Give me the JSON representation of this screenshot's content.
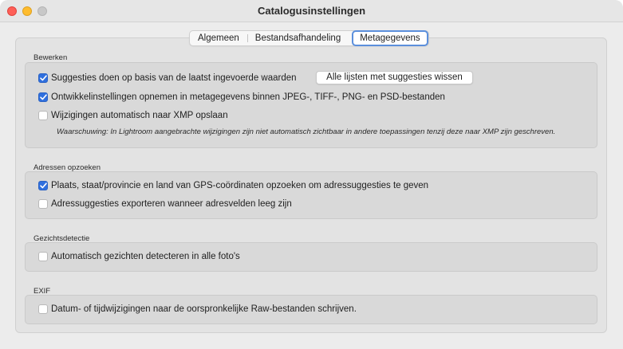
{
  "window": {
    "title": "Catalogusinstellingen",
    "controls": [
      "close",
      "minimize",
      "maximize"
    ]
  },
  "tabs": [
    {
      "label": "Algemeen",
      "active": false
    },
    {
      "label": "Bestandsafhandeling",
      "active": false
    },
    {
      "label": "Metagegevens",
      "active": true
    }
  ],
  "sections": {
    "bewerken": {
      "label": "Bewerken",
      "options": [
        {
          "label": "Suggesties doen op basis van de laatst ingevoerde waarden",
          "checked": true
        },
        {
          "label": "Ontwikkelinstellingen opnemen in metagegevens binnen JPEG-, TIFF-, PNG- en PSD-bestanden",
          "checked": true
        },
        {
          "label": "Wijzigingen automatisch naar XMP opslaan",
          "checked": false
        }
      ],
      "clear_button": "Alle lijsten met suggesties wissen",
      "warning": "Waarschuwing: In Lightroom aangebrachte wijzigingen zijn niet automatisch zichtbaar in andere toepassingen tenzij deze naar XMP zijn geschreven."
    },
    "adressen": {
      "label": "Adressen opzoeken",
      "options": [
        {
          "label": "Plaats, staat/provincie en land van GPS-coördinaten opzoeken om adressuggesties te geven",
          "checked": true
        },
        {
          "label": "Adressuggesties exporteren wanneer adresvelden leeg zijn",
          "checked": false
        }
      ]
    },
    "gezichten": {
      "label": "Gezichtsdetectie",
      "options": [
        {
          "label": "Automatisch gezichten detecteren in alle foto's",
          "checked": false
        }
      ]
    },
    "exif": {
      "label": "EXIF",
      "options": [
        {
          "label": "Datum- of tijdwijzigingen naar de oorspronkelijke Raw-bestanden schrijven.",
          "checked": false
        }
      ]
    }
  },
  "colors": {
    "accent": "#2f6fde",
    "tab_focus": "#5b8fdc"
  }
}
